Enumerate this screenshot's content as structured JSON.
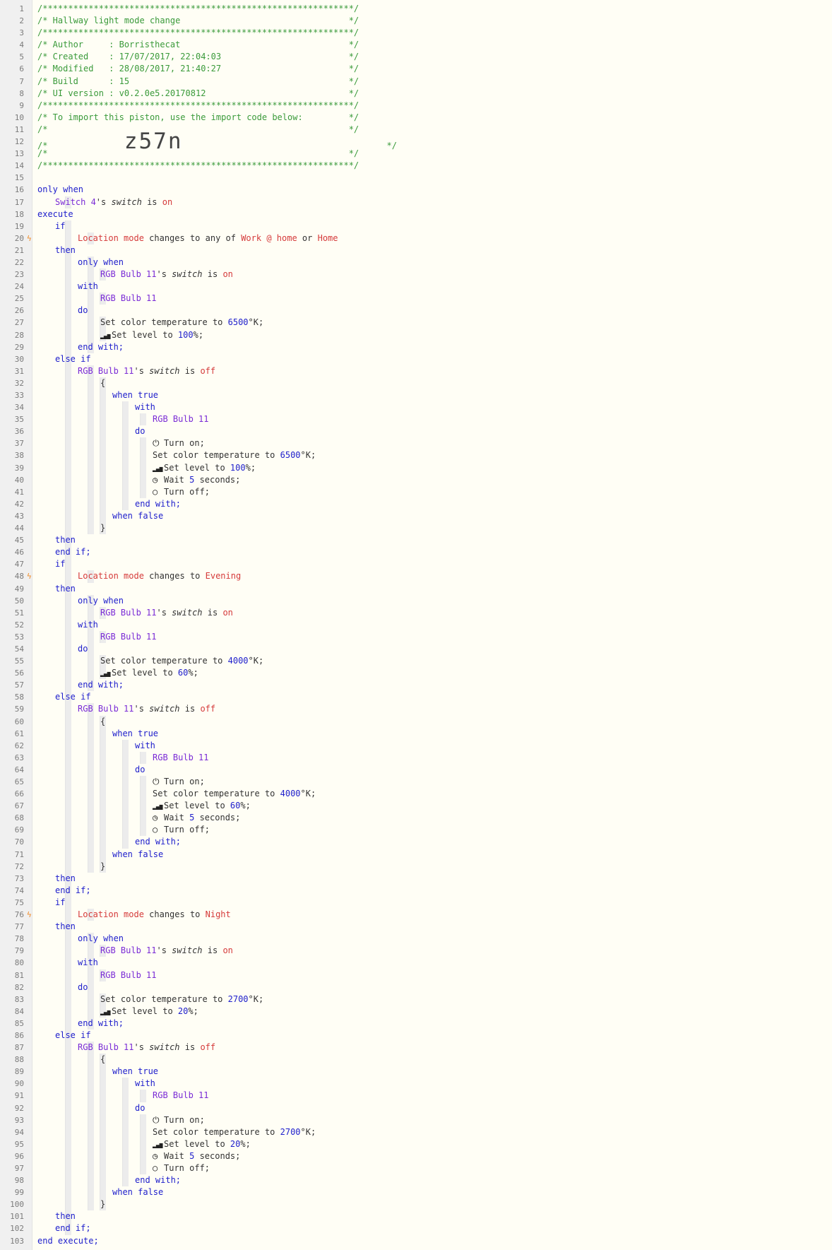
{
  "lines": [
    {
      "n": "1",
      "ind": 0,
      "toks": [
        [
          "c",
          "/*************************************************************/"
        ]
      ]
    },
    {
      "n": "2",
      "ind": 0,
      "toks": [
        [
          "c",
          "/* Hallway light mode change                                 */"
        ]
      ]
    },
    {
      "n": "3",
      "ind": 0,
      "toks": [
        [
          "c",
          "/*************************************************************/"
        ]
      ]
    },
    {
      "n": "4",
      "ind": 0,
      "toks": [
        [
          "c",
          "/* Author     : Borristhecat                                 */"
        ]
      ]
    },
    {
      "n": "5",
      "ind": 0,
      "toks": [
        [
          "c",
          "/* Created    : 17/07/2017, 22:04:03                         */"
        ]
      ]
    },
    {
      "n": "6",
      "ind": 0,
      "toks": [
        [
          "c",
          "/* Modified   : 28/08/2017, 21:40:27                         */"
        ]
      ]
    },
    {
      "n": "7",
      "ind": 0,
      "toks": [
        [
          "c",
          "/* Build      : 15                                           */"
        ]
      ]
    },
    {
      "n": "8",
      "ind": 0,
      "toks": [
        [
          "c",
          "/* UI version : v0.2.0e5.20170812                            */"
        ]
      ]
    },
    {
      "n": "9",
      "ind": 0,
      "toks": [
        [
          "c",
          "/*************************************************************/"
        ]
      ]
    },
    {
      "n": "10",
      "ind": 0,
      "toks": [
        [
          "c",
          "/* To import this piston, use the import code below:         */"
        ]
      ]
    },
    {
      "n": "11",
      "ind": 0,
      "toks": [
        [
          "c",
          "/*                                                           */"
        ]
      ]
    },
    {
      "n": "12",
      "ind": 0,
      "toks": [
        [
          "c",
          "/*               "
        ],
        [
          "big",
          "z57n"
        ],
        [
          "c",
          "                                        */"
        ]
      ]
    },
    {
      "n": "13",
      "ind": 0,
      "toks": [
        [
          "c",
          "/*                                                           */"
        ]
      ]
    },
    {
      "n": "14",
      "ind": 0,
      "toks": [
        [
          "c",
          "/*************************************************************/"
        ]
      ]
    },
    {
      "n": "15",
      "ind": 0,
      "toks": []
    },
    {
      "n": "16",
      "ind": 0,
      "toks": [
        [
          "kw",
          "only when"
        ]
      ]
    },
    {
      "n": "17",
      "ind": 1,
      "toks": [
        [
          "dev",
          "Switch 4"
        ],
        [
          "tx",
          "'s "
        ],
        [
          "it",
          "switch"
        ],
        [
          "tx",
          " is "
        ],
        [
          "val",
          "on"
        ]
      ]
    },
    {
      "n": "18",
      "ind": 0,
      "toks": [
        [
          "kw",
          "execute"
        ]
      ]
    },
    {
      "n": "19",
      "ind": 1,
      "toks": [
        [
          "kw",
          "if"
        ]
      ]
    },
    {
      "n": "20",
      "ind": 2,
      "flag": "ϟ",
      "toks": [
        [
          "val",
          "Location mode"
        ],
        [
          "tx",
          " changes to any of "
        ],
        [
          "val",
          "Work @ home"
        ],
        [
          "tx",
          " or "
        ],
        [
          "val",
          "Home"
        ]
      ]
    },
    {
      "n": "21",
      "ind": 1,
      "toks": [
        [
          "kw",
          "then"
        ]
      ]
    },
    {
      "n": "22",
      "ind": 2,
      "toks": [
        [
          "kw",
          "only when"
        ]
      ]
    },
    {
      "n": "23",
      "ind": 3,
      "toks": [
        [
          "dev",
          "RGB Bulb 11"
        ],
        [
          "tx",
          "'s "
        ],
        [
          "it",
          "switch"
        ],
        [
          "tx",
          " is "
        ],
        [
          "val",
          "on"
        ]
      ]
    },
    {
      "n": "24",
      "ind": 2,
      "toks": [
        [
          "kw",
          "with"
        ]
      ]
    },
    {
      "n": "25",
      "ind": 3,
      "toks": [
        [
          "dev",
          "RGB Bulb 11"
        ]
      ]
    },
    {
      "n": "26",
      "ind": 2,
      "toks": [
        [
          "kw",
          "do"
        ]
      ]
    },
    {
      "n": "27",
      "ind": 3,
      "toks": [
        [
          "tx",
          "Set color temperature to "
        ],
        [
          "num",
          "6500"
        ],
        [
          "tx",
          "°K;"
        ]
      ]
    },
    {
      "n": "28",
      "ind": 3,
      "toks": [
        [
          "ic",
          "signal-icon"
        ],
        [
          "tx",
          "Set level to "
        ],
        [
          "num",
          "100"
        ],
        [
          "tx",
          "%;"
        ]
      ]
    },
    {
      "n": "29",
      "ind": 2,
      "toks": [
        [
          "kw",
          "end with;"
        ]
      ]
    },
    {
      "n": "30",
      "ind": 1,
      "toks": [
        [
          "kw",
          "else if"
        ]
      ]
    },
    {
      "n": "31",
      "ind": 2,
      "toks": [
        [
          "dev",
          "RGB Bulb 11"
        ],
        [
          "tx",
          "'s "
        ],
        [
          "it",
          "switch"
        ],
        [
          "tx",
          " is "
        ],
        [
          "val",
          "off"
        ]
      ]
    },
    {
      "n": "32",
      "ind": 3,
      "toks": [
        [
          "tx",
          "{"
        ]
      ]
    },
    {
      "n": "33",
      "ind": 4,
      "toks": [
        [
          "kw",
          "when true"
        ]
      ]
    },
    {
      "n": "34",
      "ind": 5,
      "toks": [
        [
          "kw",
          "with"
        ]
      ]
    },
    {
      "n": "35",
      "ind": 6,
      "toks": [
        [
          "dev",
          "RGB Bulb 11"
        ]
      ]
    },
    {
      "n": "36",
      "ind": 5,
      "toks": [
        [
          "kw",
          "do"
        ]
      ]
    },
    {
      "n": "37",
      "ind": 6,
      "toks": [
        [
          "ic",
          "power-icon"
        ],
        [
          "tx",
          "Turn on;"
        ]
      ]
    },
    {
      "n": "38",
      "ind": 6,
      "toks": [
        [
          "tx",
          "Set color temperature to "
        ],
        [
          "num",
          "6500"
        ],
        [
          "tx",
          "°K;"
        ]
      ]
    },
    {
      "n": "39",
      "ind": 6,
      "toks": [
        [
          "ic",
          "signal-icon"
        ],
        [
          "tx",
          "Set level to "
        ],
        [
          "num",
          "100"
        ],
        [
          "tx",
          "%;"
        ]
      ]
    },
    {
      "n": "40",
      "ind": 6,
      "toks": [
        [
          "ic",
          "clock-icon"
        ],
        [
          "tx",
          "Wait "
        ],
        [
          "num",
          "5"
        ],
        [
          "tx",
          " seconds;"
        ]
      ]
    },
    {
      "n": "41",
      "ind": 6,
      "toks": [
        [
          "ic",
          "circle-icon"
        ],
        [
          "tx",
          "Turn off;"
        ]
      ]
    },
    {
      "n": "42",
      "ind": 5,
      "toks": [
        [
          "kw",
          "end with;"
        ]
      ]
    },
    {
      "n": "43",
      "ind": 4,
      "toks": [
        [
          "kw",
          "when false"
        ]
      ]
    },
    {
      "n": "44",
      "ind": 3,
      "toks": [
        [
          "tx",
          "}"
        ]
      ]
    },
    {
      "n": "45",
      "ind": 1,
      "toks": [
        [
          "kw",
          "then"
        ]
      ]
    },
    {
      "n": "46",
      "ind": 1,
      "toks": [
        [
          "kw",
          "end if;"
        ]
      ]
    },
    {
      "n": "47",
      "ind": 1,
      "toks": [
        [
          "kw",
          "if"
        ]
      ]
    },
    {
      "n": "48",
      "ind": 2,
      "flag": "ϟ",
      "toks": [
        [
          "val",
          "Location mode"
        ],
        [
          "tx",
          " changes to "
        ],
        [
          "val",
          "Evening"
        ]
      ]
    },
    {
      "n": "49",
      "ind": 1,
      "toks": [
        [
          "kw",
          "then"
        ]
      ]
    },
    {
      "n": "50",
      "ind": 2,
      "toks": [
        [
          "kw",
          "only when"
        ]
      ]
    },
    {
      "n": "51",
      "ind": 3,
      "toks": [
        [
          "dev",
          "RGB Bulb 11"
        ],
        [
          "tx",
          "'s "
        ],
        [
          "it",
          "switch"
        ],
        [
          "tx",
          " is "
        ],
        [
          "val",
          "on"
        ]
      ]
    },
    {
      "n": "52",
      "ind": 2,
      "toks": [
        [
          "kw",
          "with"
        ]
      ]
    },
    {
      "n": "53",
      "ind": 3,
      "toks": [
        [
          "dev",
          "RGB Bulb 11"
        ]
      ]
    },
    {
      "n": "54",
      "ind": 2,
      "toks": [
        [
          "kw",
          "do"
        ]
      ]
    },
    {
      "n": "55",
      "ind": 3,
      "toks": [
        [
          "tx",
          "Set color temperature to "
        ],
        [
          "num",
          "4000"
        ],
        [
          "tx",
          "°K;"
        ]
      ]
    },
    {
      "n": "56",
      "ind": 3,
      "toks": [
        [
          "ic",
          "signal-icon"
        ],
        [
          "tx",
          "Set level to "
        ],
        [
          "num",
          "60"
        ],
        [
          "tx",
          "%;"
        ]
      ]
    },
    {
      "n": "57",
      "ind": 2,
      "toks": [
        [
          "kw",
          "end with;"
        ]
      ]
    },
    {
      "n": "58",
      "ind": 1,
      "toks": [
        [
          "kw",
          "else if"
        ]
      ]
    },
    {
      "n": "59",
      "ind": 2,
      "toks": [
        [
          "dev",
          "RGB Bulb 11"
        ],
        [
          "tx",
          "'s "
        ],
        [
          "it",
          "switch"
        ],
        [
          "tx",
          " is "
        ],
        [
          "val",
          "off"
        ]
      ]
    },
    {
      "n": "60",
      "ind": 3,
      "toks": [
        [
          "tx",
          "{"
        ]
      ]
    },
    {
      "n": "61",
      "ind": 4,
      "toks": [
        [
          "kw",
          "when true"
        ]
      ]
    },
    {
      "n": "62",
      "ind": 5,
      "toks": [
        [
          "kw",
          "with"
        ]
      ]
    },
    {
      "n": "63",
      "ind": 6,
      "toks": [
        [
          "dev",
          "RGB Bulb 11"
        ]
      ]
    },
    {
      "n": "64",
      "ind": 5,
      "toks": [
        [
          "kw",
          "do"
        ]
      ]
    },
    {
      "n": "65",
      "ind": 6,
      "toks": [
        [
          "ic",
          "power-icon"
        ],
        [
          "tx",
          "Turn on;"
        ]
      ]
    },
    {
      "n": "66",
      "ind": 6,
      "toks": [
        [
          "tx",
          "Set color temperature to "
        ],
        [
          "num",
          "4000"
        ],
        [
          "tx",
          "°K;"
        ]
      ]
    },
    {
      "n": "67",
      "ind": 6,
      "toks": [
        [
          "ic",
          "signal-icon"
        ],
        [
          "tx",
          "Set level to "
        ],
        [
          "num",
          "60"
        ],
        [
          "tx",
          "%;"
        ]
      ]
    },
    {
      "n": "68",
      "ind": 6,
      "toks": [
        [
          "ic",
          "clock-icon"
        ],
        [
          "tx",
          "Wait "
        ],
        [
          "num",
          "5"
        ],
        [
          "tx",
          " seconds;"
        ]
      ]
    },
    {
      "n": "69",
      "ind": 6,
      "toks": [
        [
          "ic",
          "circle-icon"
        ],
        [
          "tx",
          "Turn off;"
        ]
      ]
    },
    {
      "n": "70",
      "ind": 5,
      "toks": [
        [
          "kw",
          "end with;"
        ]
      ]
    },
    {
      "n": "71",
      "ind": 4,
      "toks": [
        [
          "kw",
          "when false"
        ]
      ]
    },
    {
      "n": "72",
      "ind": 3,
      "toks": [
        [
          "tx",
          "}"
        ]
      ]
    },
    {
      "n": "73",
      "ind": 1,
      "toks": [
        [
          "kw",
          "then"
        ]
      ]
    },
    {
      "n": "74",
      "ind": 1,
      "toks": [
        [
          "kw",
          "end if;"
        ]
      ]
    },
    {
      "n": "75",
      "ind": 1,
      "toks": [
        [
          "kw",
          "if"
        ]
      ]
    },
    {
      "n": "76",
      "ind": 2,
      "flag": "ϟ",
      "toks": [
        [
          "val",
          "Location mode"
        ],
        [
          "tx",
          " changes to "
        ],
        [
          "val",
          "Night"
        ]
      ]
    },
    {
      "n": "77",
      "ind": 1,
      "toks": [
        [
          "kw",
          "then"
        ]
      ]
    },
    {
      "n": "78",
      "ind": 2,
      "toks": [
        [
          "kw",
          "only when"
        ]
      ]
    },
    {
      "n": "79",
      "ind": 3,
      "toks": [
        [
          "dev",
          "RGB Bulb 11"
        ],
        [
          "tx",
          "'s "
        ],
        [
          "it",
          "switch"
        ],
        [
          "tx",
          " is "
        ],
        [
          "val",
          "on"
        ]
      ]
    },
    {
      "n": "80",
      "ind": 2,
      "toks": [
        [
          "kw",
          "with"
        ]
      ]
    },
    {
      "n": "81",
      "ind": 3,
      "toks": [
        [
          "dev",
          "RGB Bulb 11"
        ]
      ]
    },
    {
      "n": "82",
      "ind": 2,
      "toks": [
        [
          "kw",
          "do"
        ]
      ]
    },
    {
      "n": "83",
      "ind": 3,
      "toks": [
        [
          "tx",
          "Set color temperature to "
        ],
        [
          "num",
          "2700"
        ],
        [
          "tx",
          "°K;"
        ]
      ]
    },
    {
      "n": "84",
      "ind": 3,
      "toks": [
        [
          "ic",
          "signal-icon"
        ],
        [
          "tx",
          "Set level to "
        ],
        [
          "num",
          "20"
        ],
        [
          "tx",
          "%;"
        ]
      ]
    },
    {
      "n": "85",
      "ind": 2,
      "toks": [
        [
          "kw",
          "end with;"
        ]
      ]
    },
    {
      "n": "86",
      "ind": 1,
      "toks": [
        [
          "kw",
          "else if"
        ]
      ]
    },
    {
      "n": "87",
      "ind": 2,
      "toks": [
        [
          "dev",
          "RGB Bulb 11"
        ],
        [
          "tx",
          "'s "
        ],
        [
          "it",
          "switch"
        ],
        [
          "tx",
          " is "
        ],
        [
          "val",
          "off"
        ]
      ]
    },
    {
      "n": "88",
      "ind": 3,
      "toks": [
        [
          "tx",
          "{"
        ]
      ]
    },
    {
      "n": "89",
      "ind": 4,
      "toks": [
        [
          "kw",
          "when true"
        ]
      ]
    },
    {
      "n": "90",
      "ind": 5,
      "toks": [
        [
          "kw",
          "with"
        ]
      ]
    },
    {
      "n": "91",
      "ind": 6,
      "toks": [
        [
          "dev",
          "RGB Bulb 11"
        ]
      ]
    },
    {
      "n": "92",
      "ind": 5,
      "toks": [
        [
          "kw",
          "do"
        ]
      ]
    },
    {
      "n": "93",
      "ind": 6,
      "toks": [
        [
          "ic",
          "power-icon"
        ],
        [
          "tx",
          "Turn on;"
        ]
      ]
    },
    {
      "n": "94",
      "ind": 6,
      "toks": [
        [
          "tx",
          "Set color temperature to "
        ],
        [
          "num",
          "2700"
        ],
        [
          "tx",
          "°K;"
        ]
      ]
    },
    {
      "n": "95",
      "ind": 6,
      "toks": [
        [
          "ic",
          "signal-icon"
        ],
        [
          "tx",
          "Set level to "
        ],
        [
          "num",
          "20"
        ],
        [
          "tx",
          "%;"
        ]
      ]
    },
    {
      "n": "96",
      "ind": 6,
      "toks": [
        [
          "ic",
          "clock-icon"
        ],
        [
          "tx",
          "Wait "
        ],
        [
          "num",
          "5"
        ],
        [
          "tx",
          " seconds;"
        ]
      ]
    },
    {
      "n": "97",
      "ind": 6,
      "toks": [
        [
          "ic",
          "circle-icon"
        ],
        [
          "tx",
          "Turn off;"
        ]
      ]
    },
    {
      "n": "98",
      "ind": 5,
      "toks": [
        [
          "kw",
          "end with;"
        ]
      ]
    },
    {
      "n": "99",
      "ind": 4,
      "toks": [
        [
          "kw",
          "when false"
        ]
      ]
    },
    {
      "n": "100",
      "ind": 3,
      "toks": [
        [
          "tx",
          "}"
        ]
      ]
    },
    {
      "n": "101",
      "ind": 1,
      "toks": [
        [
          "kw",
          "then"
        ]
      ]
    },
    {
      "n": "102",
      "ind": 1,
      "toks": [
        [
          "kw",
          "end if;"
        ]
      ]
    },
    {
      "n": "103",
      "ind": 0,
      "toks": [
        [
          "kw",
          "end execute;"
        ]
      ]
    }
  ]
}
